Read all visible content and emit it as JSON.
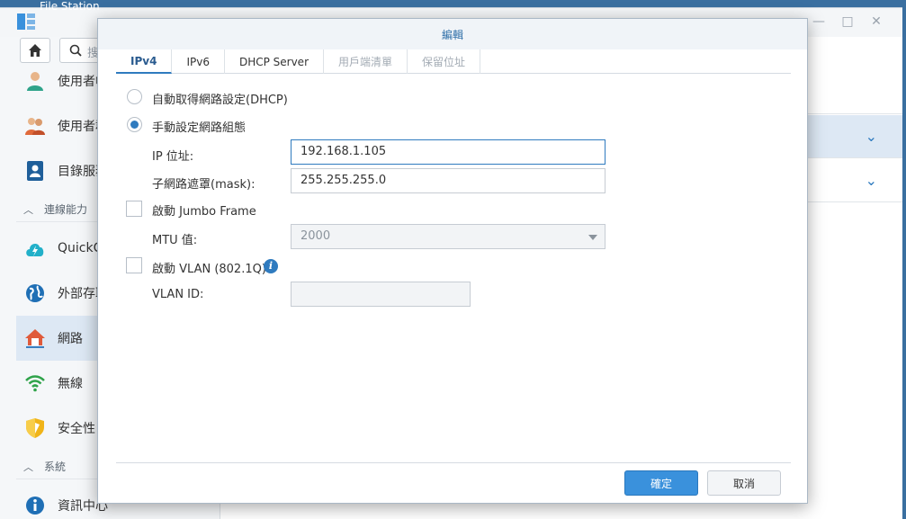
{
  "app": {
    "title": "File Station",
    "search_placeholder": "搜"
  },
  "sidebar": {
    "items": [
      {
        "label": "使用者帳",
        "icon": "user-icon"
      },
      {
        "label": "使用者群",
        "icon": "users-group-icon"
      },
      {
        "label": "目錄服務",
        "icon": "directory-icon"
      },
      {
        "section": "連線能力"
      },
      {
        "label": "QuickCo",
        "icon": "quickconnect-icon"
      },
      {
        "label": "外部存取",
        "icon": "globe-icon"
      },
      {
        "label": "網路",
        "icon": "network-home-icon",
        "selected": true
      },
      {
        "label": "無線",
        "icon": "wifi-icon"
      },
      {
        "label": "安全性",
        "icon": "shield-icon"
      },
      {
        "section": "系統"
      },
      {
        "label": "資訊中心",
        "icon": "info-icon"
      }
    ]
  },
  "dialog": {
    "title": "編輯",
    "tabs": [
      {
        "label": "IPv4",
        "state": "active"
      },
      {
        "label": "IPv6",
        "state": "normal"
      },
      {
        "label": "DHCP Server",
        "state": "normal"
      },
      {
        "label": "用戶端清單",
        "state": "disabled"
      },
      {
        "label": "保留位址",
        "state": "disabled"
      }
    ],
    "dhcp_option": {
      "label": "自動取得網路設定(DHCP)",
      "checked": false
    },
    "manual_option": {
      "label": "手動設定網路組態",
      "checked": true
    },
    "ip_label": "IP 位址:",
    "ip_value": "192.168.1.105",
    "mask_label": "子網路遮罩(mask):",
    "mask_value": "255.255.255.0",
    "jumbo_label": "啟動 Jumbo Frame",
    "jumbo_checked": false,
    "mtu_label": "MTU 值:",
    "mtu_value": "2000",
    "vlan_label": "啟動 VLAN (802.1Q)",
    "vlan_checked": false,
    "vlan_id_label": "VLAN ID:",
    "vlan_id_value": "",
    "ok_label": "確定",
    "cancel_label": "取消"
  },
  "colors": {
    "accent": "#2f7bbf",
    "primary_button": "#3a91dc",
    "selected_row": "#dde8f4"
  }
}
